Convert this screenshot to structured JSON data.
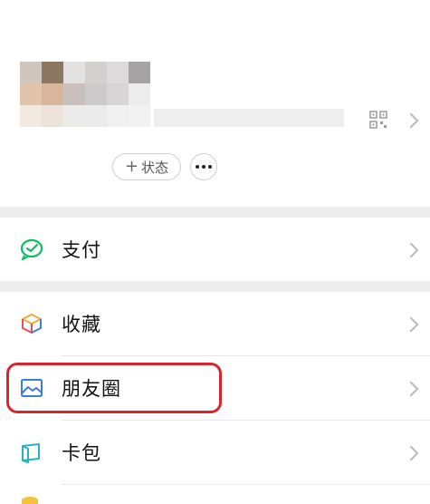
{
  "profile": {
    "status_label": "状态",
    "status_plus": "+",
    "avatar_mosaic_colors": [
      [
        "#cfc6bd",
        "#8c7762",
        "#e4e2e0",
        "#d3d1d0",
        "#dcdadb",
        "#a5a3a4"
      ],
      [
        "#e2c3ac",
        "#d7b69b",
        "#c9bfbc",
        "#cdcacb",
        "#d7d5d5",
        "#ececec"
      ],
      [
        "#f4e9df",
        "#ede3d9",
        "#ecebe9",
        "#ecebeb",
        "#f0f0f0",
        "#f2f2f2"
      ]
    ]
  },
  "menu": [
    {
      "label": "支付",
      "icon": "wechat-pay-icon",
      "color": "#07c160"
    },
    {
      "label": "收藏",
      "icon": "favorites-cube-icon",
      "color": "#f0a93c"
    },
    {
      "label": "朋友圈",
      "icon": "moments-image-icon",
      "color": "#3b7dd8"
    },
    {
      "label": "卡包",
      "icon": "card-wallet-icon",
      "color": "#29b2c3"
    }
  ],
  "colors": {
    "highlight": "#d9262e",
    "divider_bg": "#ededed",
    "chevron": "#b9b9b9"
  }
}
